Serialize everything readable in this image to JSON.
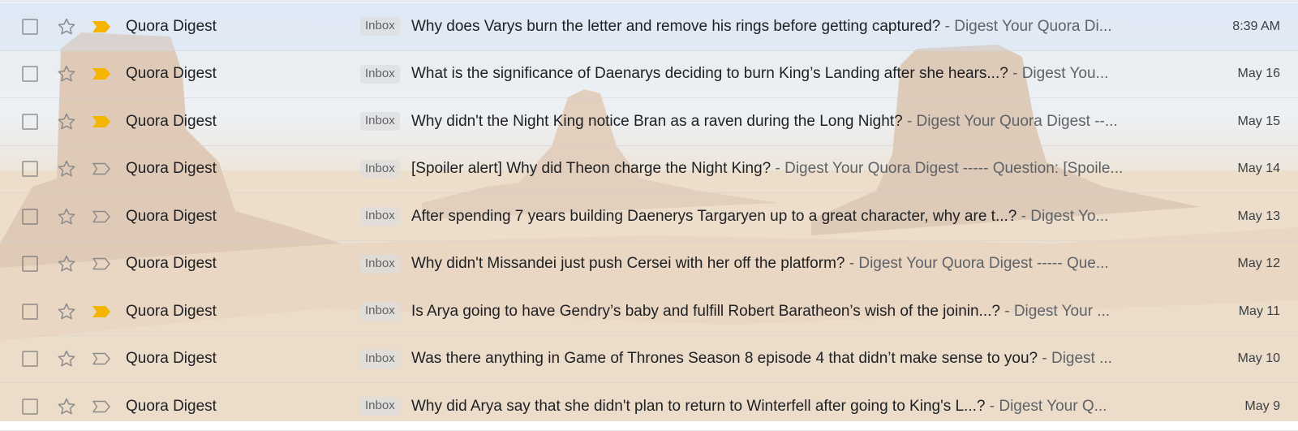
{
  "colors": {
    "important_marker": "#f4b400",
    "muted_icon": "#8a8a8a",
    "text_primary": "#202124",
    "text_secondary": "#5f6368"
  },
  "icons": {
    "checkbox": "checkbox-icon",
    "star": "star-outline-icon",
    "important": "importance-marker-icon"
  },
  "emails": [
    {
      "sender": "Quora Digest",
      "label": "Inbox",
      "subject": "Why does Varys burn the letter and remove his rings before getting captured?",
      "snippet": " - Digest Your Quora Di...",
      "date": "8:39 AM",
      "important": true
    },
    {
      "sender": "Quora Digest",
      "label": "Inbox",
      "subject": "What is the significance of Daenarys deciding to burn King’s Landing after she hears...?",
      "snippet": " - Digest You...",
      "date": "May 16",
      "important": true
    },
    {
      "sender": "Quora Digest",
      "label": "Inbox",
      "subject": "Why didn't the Night King notice Bran as a raven during the Long Night?",
      "snippet": " - Digest Your Quora Digest --...",
      "date": "May 15",
      "important": true
    },
    {
      "sender": "Quora Digest",
      "label": "Inbox",
      "subject": "[Spoiler alert] Why did Theon charge the Night King?",
      "snippet": " - Digest Your Quora Digest ----- Question: [Spoile...",
      "date": "May 14",
      "important": false
    },
    {
      "sender": "Quora Digest",
      "label": "Inbox",
      "subject": "After spending 7 years building Daenerys Targaryen up to a great character, why are t...?",
      "snippet": " - Digest Yo...",
      "date": "May 13",
      "important": false
    },
    {
      "sender": "Quora Digest",
      "label": "Inbox",
      "subject": "Why didn't Missandei just push Cersei with her off the platform?",
      "snippet": " - Digest Your Quora Digest ----- Que...",
      "date": "May 12",
      "important": false
    },
    {
      "sender": "Quora Digest",
      "label": "Inbox",
      "subject": "Is Arya going to have Gendry’s baby and fulfill Robert Baratheon’s wish of the joinin...?",
      "snippet": " - Digest Your ...",
      "date": "May 11",
      "important": true
    },
    {
      "sender": "Quora Digest",
      "label": "Inbox",
      "subject": "Was there anything in Game of Thrones Season 8 episode 4 that didn’t make sense to you?",
      "snippet": " - Digest ...",
      "date": "May 10",
      "important": false
    },
    {
      "sender": "Quora Digest",
      "label": "Inbox",
      "subject": "Why did Arya say that she didn't plan to return to Winterfell after going to King's L...?",
      "snippet": " - Digest Your Q...",
      "date": "May 9",
      "important": false
    }
  ]
}
